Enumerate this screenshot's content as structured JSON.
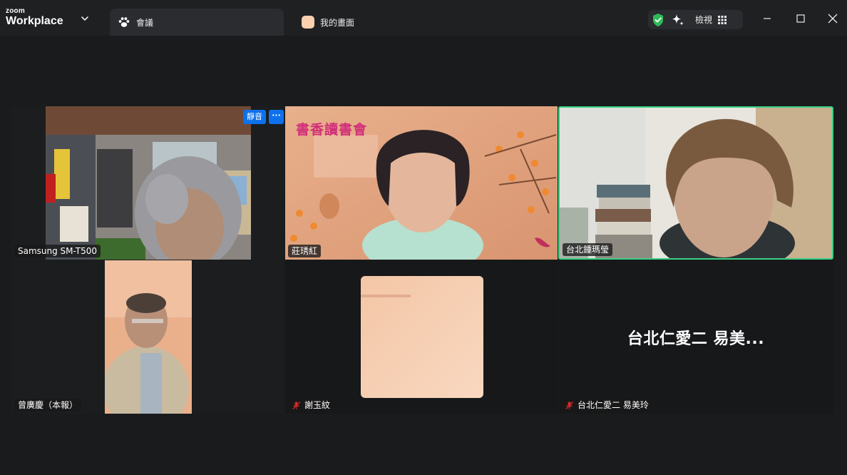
{
  "app": {
    "brand_top": "zoom",
    "brand_bottom": "Workplace"
  },
  "tabs": [
    {
      "label": "會議",
      "active": true,
      "icon": "paw-icon"
    },
    {
      "label": "我的畫面",
      "active": false,
      "icon": "home-swatch-icon"
    }
  ],
  "toolbar": {
    "security_icon": "shield-check-icon",
    "ai_icon": "sparkle-icon",
    "view_label": "檢視",
    "view_icon": "grid-icon"
  },
  "window_controls": [
    "minimize-icon",
    "maximize-icon",
    "close-icon"
  ],
  "colors": {
    "background": "#1a1b1d",
    "titlebar": "#1f2022",
    "active_tab": "#2b2c2f",
    "speaker_border": "#38d184",
    "accent_blue": "#0e71eb",
    "muted_red": "#e02828",
    "shield_green": "#2dbb5a"
  },
  "participants": [
    {
      "name": "Samsung SM-T500",
      "muted": false,
      "video_on": true,
      "active_speaker": false,
      "hover_chip": "靜音",
      "more_chip": "···"
    },
    {
      "name": "莊琇紅",
      "muted": false,
      "video_on": true,
      "active_speaker": false,
      "background_logo": "書香讀書會"
    },
    {
      "name": "台北鍾瑪瑩",
      "muted": false,
      "video_on": true,
      "active_speaker": true
    },
    {
      "name": "曾廣慶（本報）",
      "muted": false,
      "video_on": true,
      "active_speaker": false
    },
    {
      "name": "謝玉紋",
      "muted": true,
      "video_on": true,
      "active_speaker": false
    },
    {
      "name": "台北仁愛二 易美玲",
      "muted": true,
      "video_on": false,
      "active_speaker": false,
      "display_name": "台北仁愛二 易美..."
    }
  ]
}
